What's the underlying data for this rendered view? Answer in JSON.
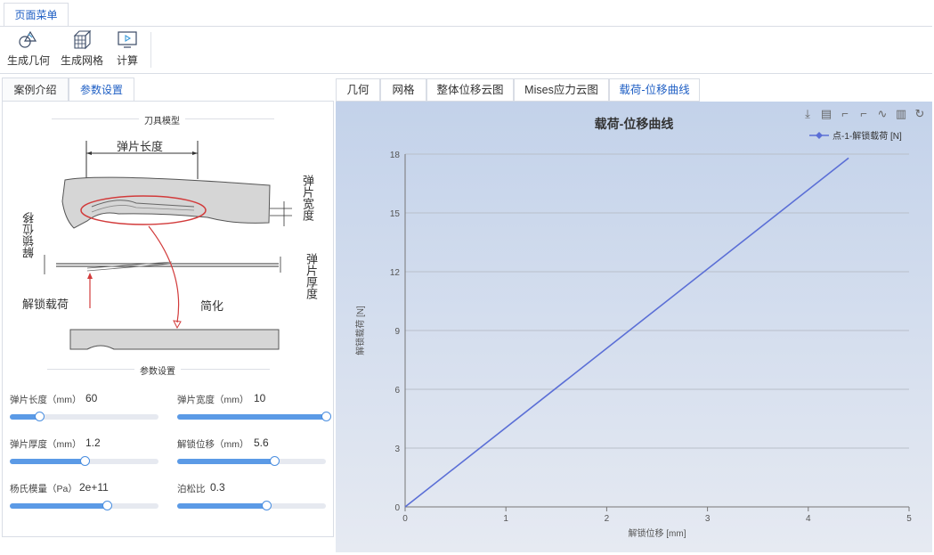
{
  "menu": {
    "page_menu": "页面菜单"
  },
  "toolbar": {
    "gen_geometry": "生成几何",
    "gen_mesh": "生成网格",
    "compute": "计算"
  },
  "left_tabs": [
    {
      "label": "案例介绍",
      "active": false
    },
    {
      "label": "参数设置",
      "active": true
    }
  ],
  "model": {
    "section_title": "刀具模型",
    "spring_length": "弹片长度",
    "spring_width": "弹片宽度",
    "unlock_disp": "解锁位移",
    "spring_thickness": "弹片厚度",
    "unlock_load": "解锁载荷",
    "simplify": "简化"
  },
  "params": {
    "section_title": "参数设置",
    "items": [
      {
        "label": "弹片长度（mm）",
        "value": "60",
        "fraction": 0.2
      },
      {
        "label": "弹片宽度（mm）",
        "value": "10",
        "fraction": 1.0
      },
      {
        "label": "弹片厚度（mm）",
        "value": "1.2",
        "fraction": 0.5
      },
      {
        "label": "解锁位移（mm）",
        "value": "5.6",
        "fraction": 0.65
      },
      {
        "label": "杨氏模量（Pa）",
        "value": "2e+11",
        "fraction": 0.65
      },
      {
        "label": "泊松比",
        "value": "0.3",
        "fraction": 0.6
      }
    ]
  },
  "right_tabs": [
    {
      "label": "几何",
      "active": false
    },
    {
      "label": "网格",
      "active": false
    },
    {
      "label": "整体位移云图",
      "active": false
    },
    {
      "label": "Mises应力云图",
      "active": false
    },
    {
      "label": "载荷-位移曲线",
      "active": true
    }
  ],
  "chart_icons": [
    "download-icon",
    "document-icon",
    "crop-icon",
    "crop-alt-icon",
    "line-chart-icon",
    "bar-chart-icon",
    "refresh-icon"
  ],
  "chart_data": {
    "type": "line",
    "title": "载荷-位移曲线",
    "xlabel": "解锁位移 [mm]",
    "ylabel": "解锁载荷 [N]",
    "xlim": [
      0,
      5
    ],
    "ylim": [
      0,
      18
    ],
    "xticks": [
      "0",
      "1",
      "2",
      "3",
      "4",
      "5"
    ],
    "yticks": [
      "0",
      "3",
      "6",
      "9",
      "12",
      "15",
      "18"
    ],
    "legend_position": "top-right",
    "grid": true,
    "series": [
      {
        "name": "点-1-解锁载荷 [N]",
        "color": "#5b6fd6",
        "x": [
          0,
          4.4
        ],
        "y": [
          0,
          17.8
        ]
      }
    ]
  }
}
